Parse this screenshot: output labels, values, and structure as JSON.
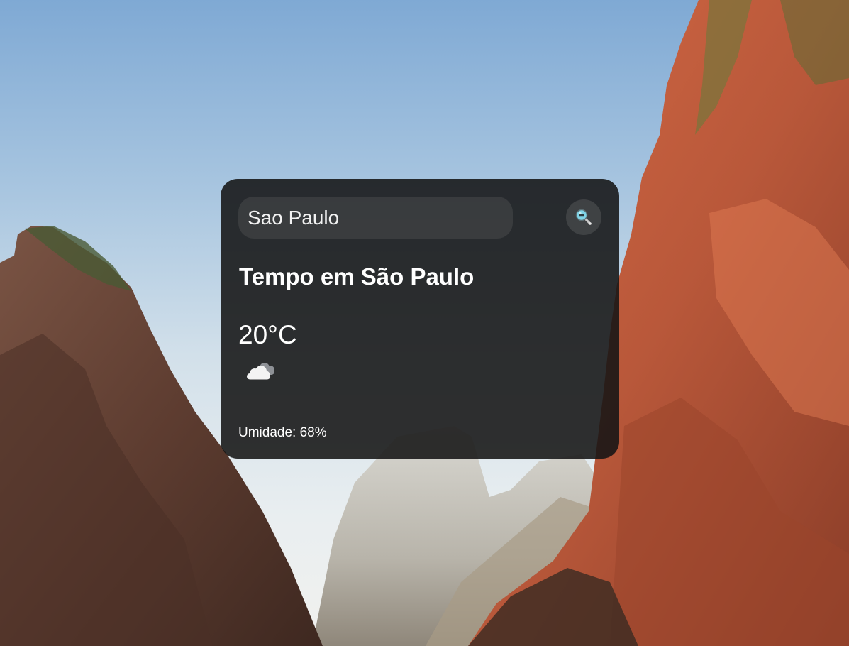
{
  "search": {
    "value": "Sao Paulo",
    "placeholder": "Sao Paulo"
  },
  "search_button": {
    "icon": "magnifier-icon"
  },
  "weather": {
    "title": "Tempo em São Paulo",
    "temperature": "20°C",
    "icon": "cloudy-icon",
    "humidity": "Umidade: 68%"
  },
  "colors": {
    "card_background": "#141414",
    "text": "#ffffff",
    "sky_top": "#7fa9d4",
    "rock_left": "#6b4537",
    "rock_right": "#c8603e"
  }
}
